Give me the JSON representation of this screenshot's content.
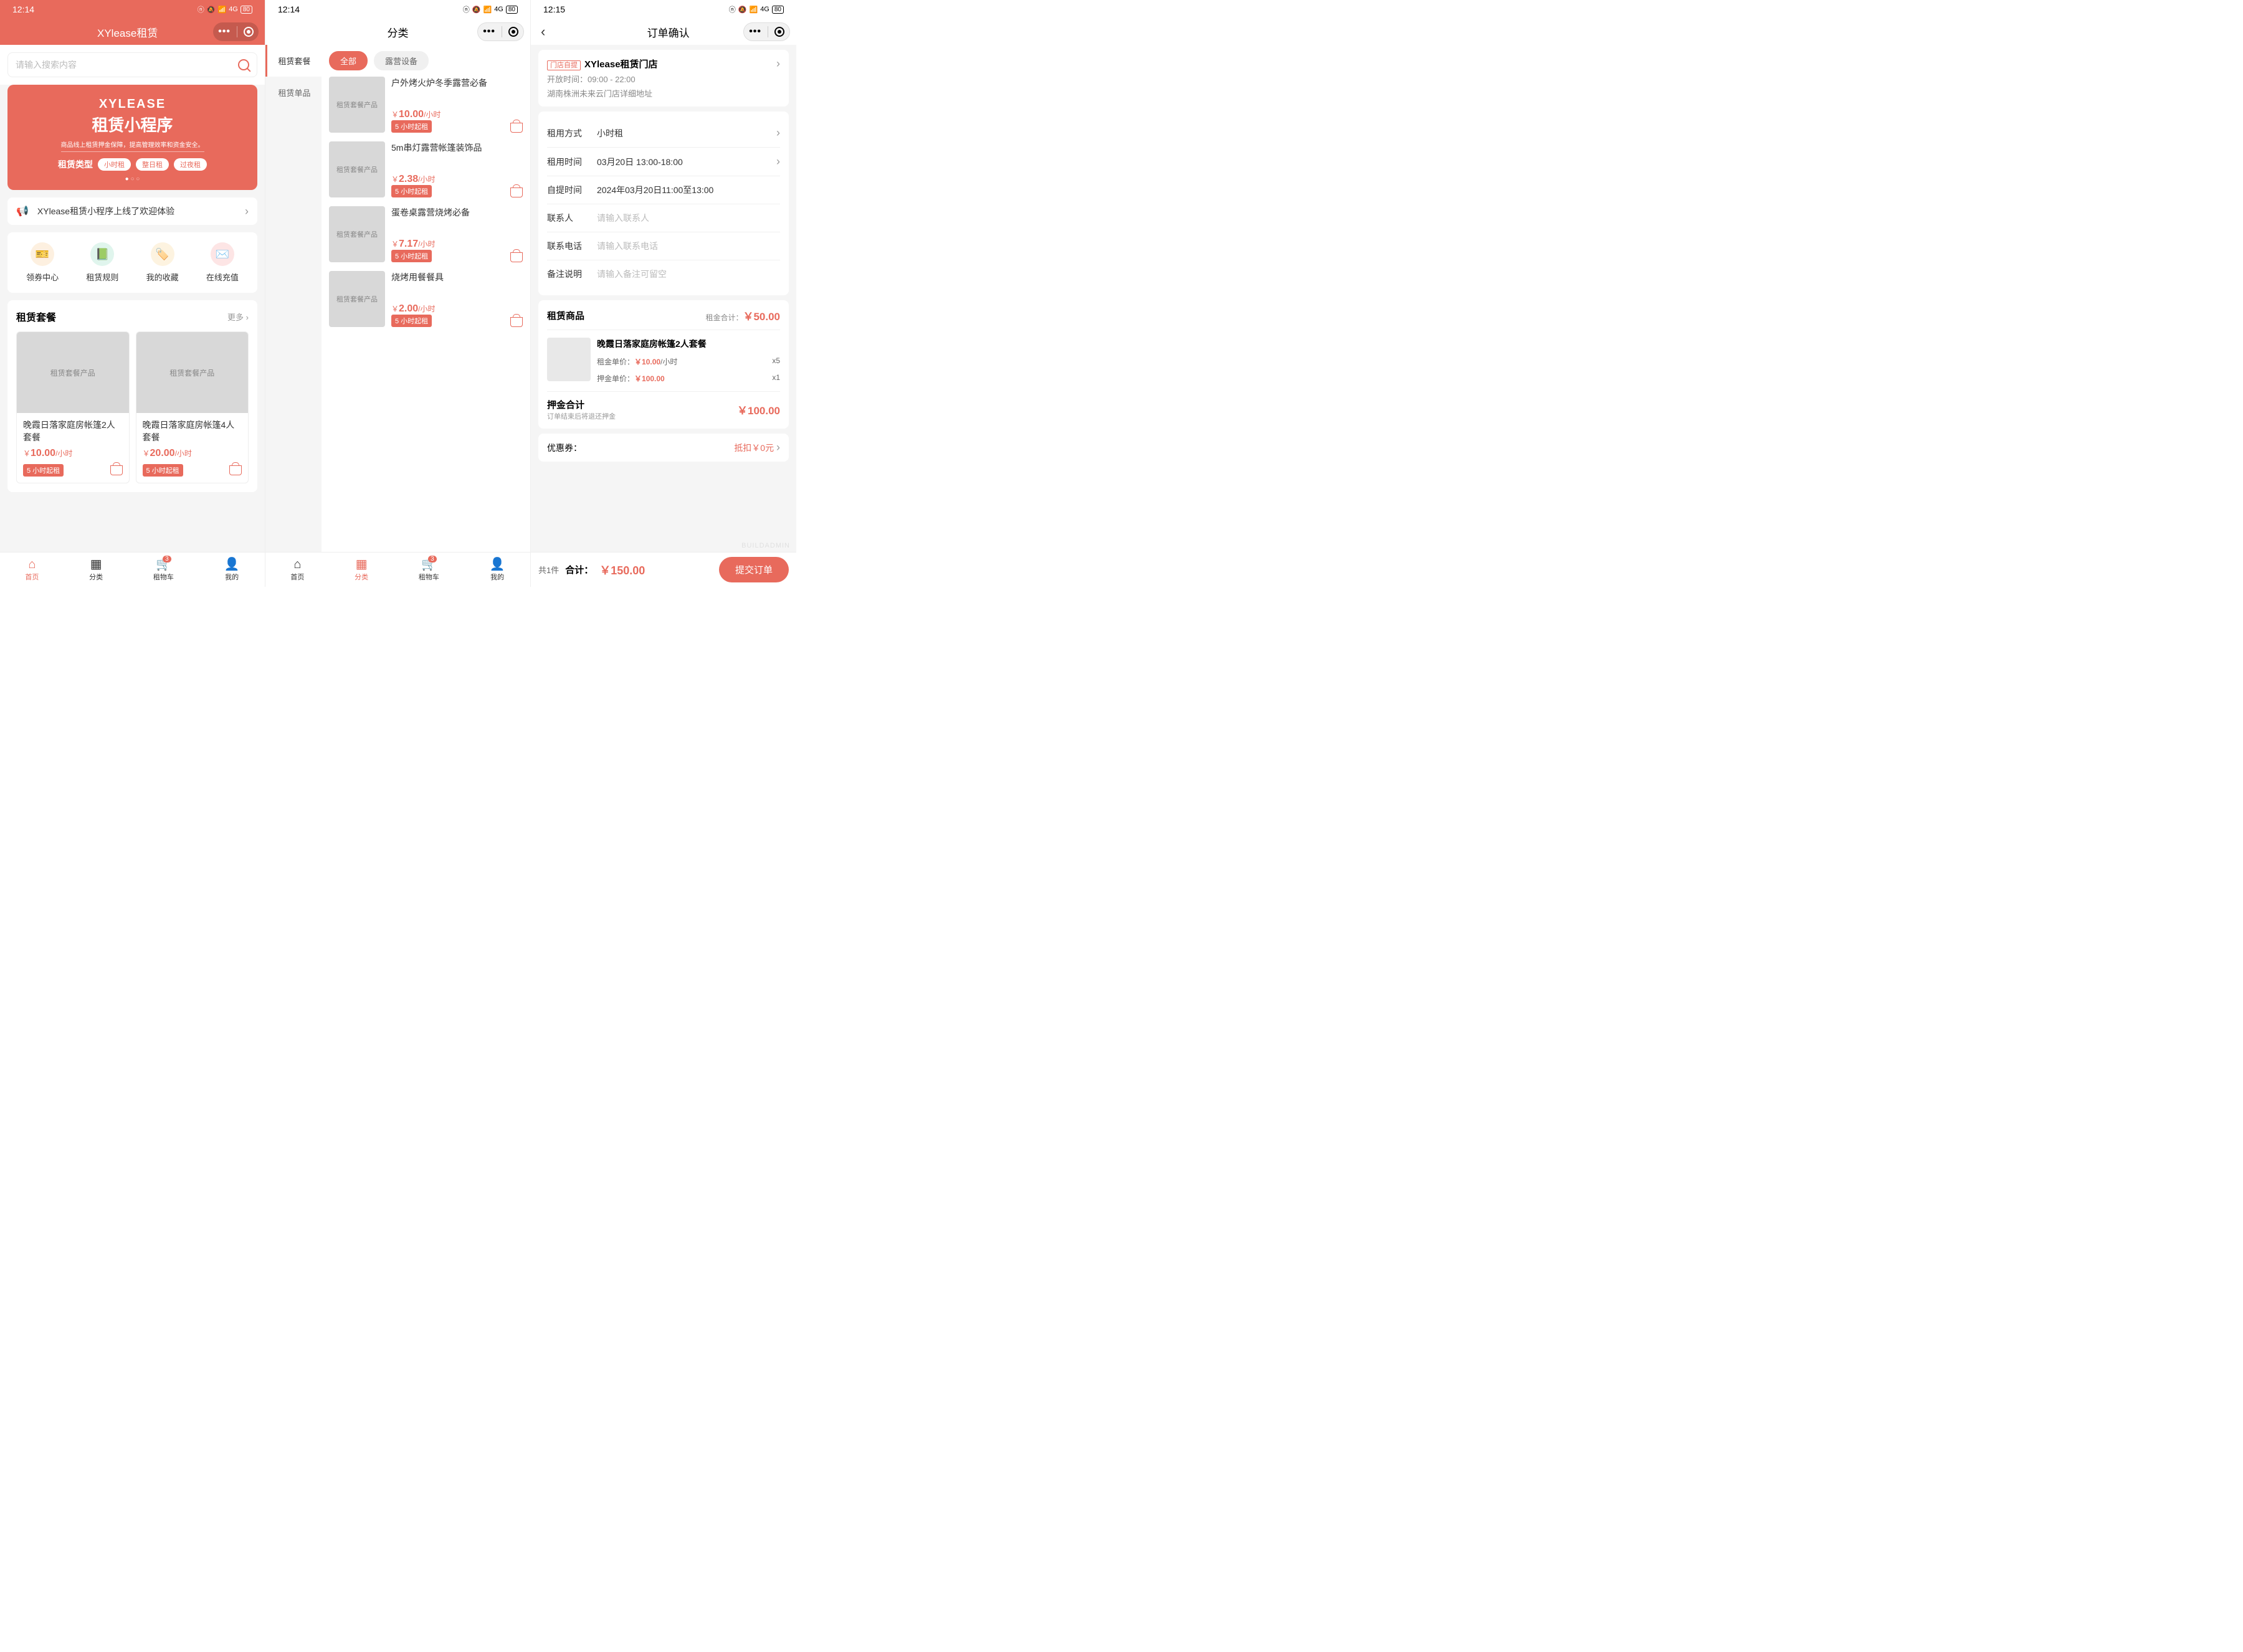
{
  "status": {
    "time1": "12:14",
    "time2": "12:14",
    "time3": "12:15",
    "battery": "80",
    "signal": "4G"
  },
  "screen1": {
    "app_title": "XYlease租赁",
    "search_placeholder": "请输入搜索内容",
    "banner": {
      "brand": "XYLEASE",
      "title": "租赁小程序",
      "subtitle": "商品线上租赁押金保障，提高管理效率和资金安全。",
      "type_label": "租赁类型",
      "types": [
        "小时租",
        "整日租",
        "过夜租"
      ]
    },
    "notice": "XYlease租赁小程序上线了欢迎体验",
    "quick": [
      {
        "label": "领券中心",
        "icon": "🎫",
        "color": "orange"
      },
      {
        "label": "租赁规则",
        "icon": "📗",
        "color": "green"
      },
      {
        "label": "我的收藏",
        "icon": "🏷️",
        "color": "yellow"
      },
      {
        "label": "在线充值",
        "icon": "✉️",
        "color": "pink"
      }
    ],
    "section_title": "租赁套餐",
    "more": "更多",
    "products": [
      {
        "img_label": "租赁套餐产品",
        "title": "晚霞日落家庭房帐篷2人套餐",
        "price": "10.00",
        "unit": "/小时",
        "tag": "5 小时起租"
      },
      {
        "img_label": "租赁套餐产品",
        "title": "晚霞日落家庭房帐篷4人套餐",
        "price": "20.00",
        "unit": "/小时",
        "tag": "5 小时起租"
      }
    ]
  },
  "tabs": [
    {
      "label": "首页",
      "icon": "⌂"
    },
    {
      "label": "分类",
      "icon": "▦"
    },
    {
      "label": "租物车",
      "icon": "🛒",
      "badge": "3"
    },
    {
      "label": "我的",
      "icon": "👤"
    }
  ],
  "screen2": {
    "title": "分类",
    "sidebar": [
      "租赁套餐",
      "租赁单品"
    ],
    "filters": [
      "全部",
      "露营设备"
    ],
    "list": [
      {
        "img_label": "租赁套餐产品",
        "title": "户外烤火炉冬季露营必备",
        "price": "10.00",
        "unit": "/小时",
        "tag": "5 小时起租"
      },
      {
        "img_label": "租赁套餐产品",
        "title": "5m串灯露营帐篷装饰品",
        "price": "2.38",
        "unit": "/小时",
        "tag": "5 小时起租"
      },
      {
        "img_label": "租赁套餐产品",
        "title": "蛋卷桌露营烧烤必备",
        "price": "7.17",
        "unit": "/小时",
        "tag": "5 小时起租"
      },
      {
        "img_label": "租赁套餐产品",
        "title": "烧烤用餐餐具",
        "price": "2.00",
        "unit": "/小时",
        "tag": "5 小时起租"
      }
    ]
  },
  "screen3": {
    "title": "订单确认",
    "store": {
      "tag": "门店自提",
      "name": "XYlease租赁门店",
      "hours_label": "开放时间：",
      "hours": "09:00 - 22:00",
      "address": "湖南株洲未来云门店详细地址"
    },
    "form": {
      "method_label": "租用方式",
      "method_value": "小时租",
      "time_label": "租用时间",
      "time_value": "03月20日 13:00-18:00",
      "pickup_label": "自提时间",
      "pickup_value": "2024年03月20日11:00至13:00",
      "contact_label": "联系人",
      "contact_placeholder": "请输入联系人",
      "phone_label": "联系电话",
      "phone_placeholder": "请输入联系电话",
      "remark_label": "备注说明",
      "remark_placeholder": "请输入备注可留空"
    },
    "rent": {
      "title": "租赁商品",
      "total_label": "租金合计：",
      "total": "￥50.00",
      "item_title": "晚霞日落家庭房帐篷2人套餐",
      "unit_label": "租金单价：",
      "unit_price": "￥10.00",
      "unit_suffix": "/小时",
      "qty": "x5",
      "deposit_unit_label": "押金单价：",
      "deposit_unit": "￥100.00",
      "deposit_qty": "x1"
    },
    "deposit": {
      "label": "押金合计",
      "sub": "订单结束后将退还押金",
      "value": "￥100.00"
    },
    "coupon": {
      "label": "优惠券：",
      "value": "抵扣￥0元"
    },
    "bottom": {
      "count": "共1件",
      "total_label": "合计：",
      "total": "￥150.00",
      "submit": "提交订单"
    }
  },
  "watermark": "BUILDADMIN"
}
